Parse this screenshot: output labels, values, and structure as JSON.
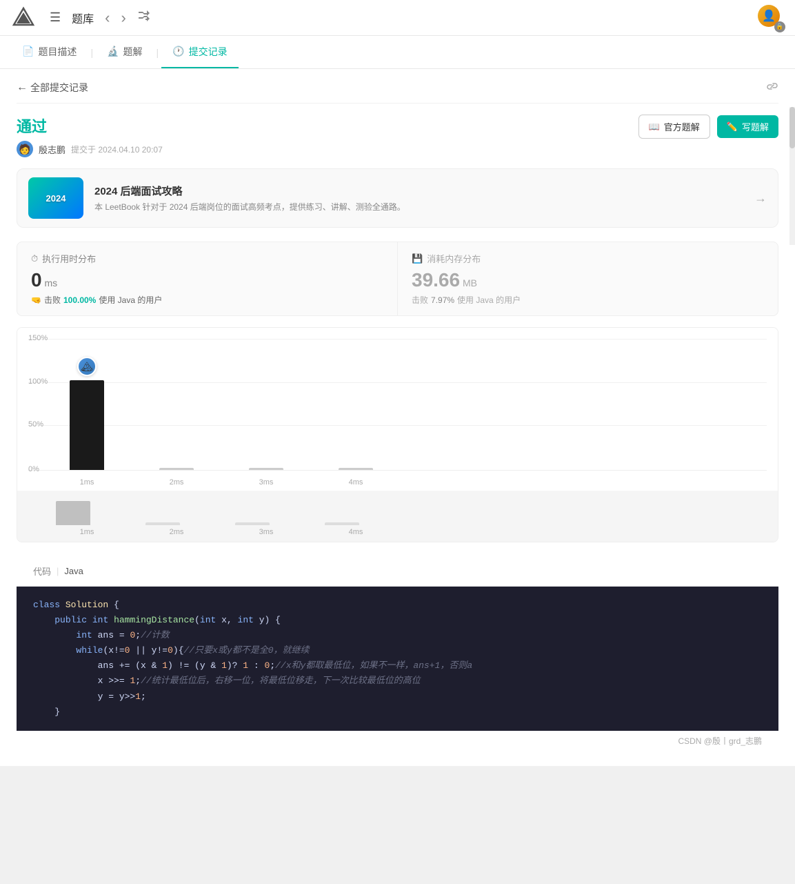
{
  "topNav": {
    "listIconSymbol": "☰",
    "title": "题库",
    "prevArrow": "‹",
    "nextArrow": "›",
    "shuffleSymbol": "⇄"
  },
  "tabs": [
    {
      "id": "description",
      "label": "题目描述",
      "icon": "📄",
      "active": false
    },
    {
      "id": "solution",
      "label": "题解",
      "icon": "🔬",
      "active": false
    },
    {
      "id": "submissions",
      "label": "提交记录",
      "icon": "🕐",
      "active": true
    }
  ],
  "submissionsPage": {
    "backLabel": "全部提交记录",
    "status": "通过",
    "submitter": "殷志鹏",
    "submitTime": "提交于 2024.04.10 20:07",
    "officialSolutionLabel": "官方题解",
    "writeSolutionLabel": "写题解",
    "book": {
      "title": "2024 后端面试攻略",
      "desc": "本 LeetBook 针对于 2024 后端岗位的面试高频考点，提供练习、讲解、测验全通路。",
      "year": "2024"
    },
    "stats": {
      "timeTitle": "执行用时分布",
      "timeValue": "0",
      "timeUnit": "ms",
      "timeBeatPrefix": "击败",
      "timeBeatPct": "100.00%",
      "timeBeatSuffix": "使用 Java 的用户",
      "memTitle": "消耗内存分布",
      "memValue": "39.66",
      "memUnit": "MB",
      "memBeatPrefix": "击败",
      "memBeatPct": "7.97%",
      "memBeatSuffix": "使用 Java 的用户"
    },
    "chart": {
      "yLabels": [
        "150%",
        "100%",
        "50%",
        "0%"
      ],
      "xLabels": [
        "1ms",
        "2ms",
        "3ms",
        "4ms"
      ],
      "bars": [
        100,
        2,
        2,
        2
      ],
      "miniXLabels": [
        "1ms",
        "2ms",
        "3ms",
        "4ms"
      ],
      "miniBars": [
        60,
        5,
        5,
        5
      ]
    },
    "code": {
      "label": "代码",
      "lang": "Java",
      "lines": [
        {
          "indent": 0,
          "text": "class Solution {",
          "type": "plain"
        },
        {
          "indent": 1,
          "text": "public int hammingDistance(int x, int y) {",
          "type": "plain"
        },
        {
          "indent": 2,
          "text": "int ans = 0;//计数",
          "type": "plain"
        },
        {
          "indent": 2,
          "text": "while(x!=0 || y!=0){//只要x或y都不是全0，就继续",
          "type": "plain"
        },
        {
          "indent": 3,
          "text": "ans += (x & 1) != (y & 1)? 1 : 0;//x和y都取最低位，如果不一样，ans+1，否则a",
          "type": "plain"
        },
        {
          "indent": 3,
          "text": "x >>= 1;//统计最低位后，右移一位，将最低位移走，下一次比较最低位的高位",
          "type": "plain"
        },
        {
          "indent": 3,
          "text": "y = y>>1;",
          "type": "plain"
        }
      ],
      "footer": "CSDN @殷丨grd_志鹏"
    }
  }
}
